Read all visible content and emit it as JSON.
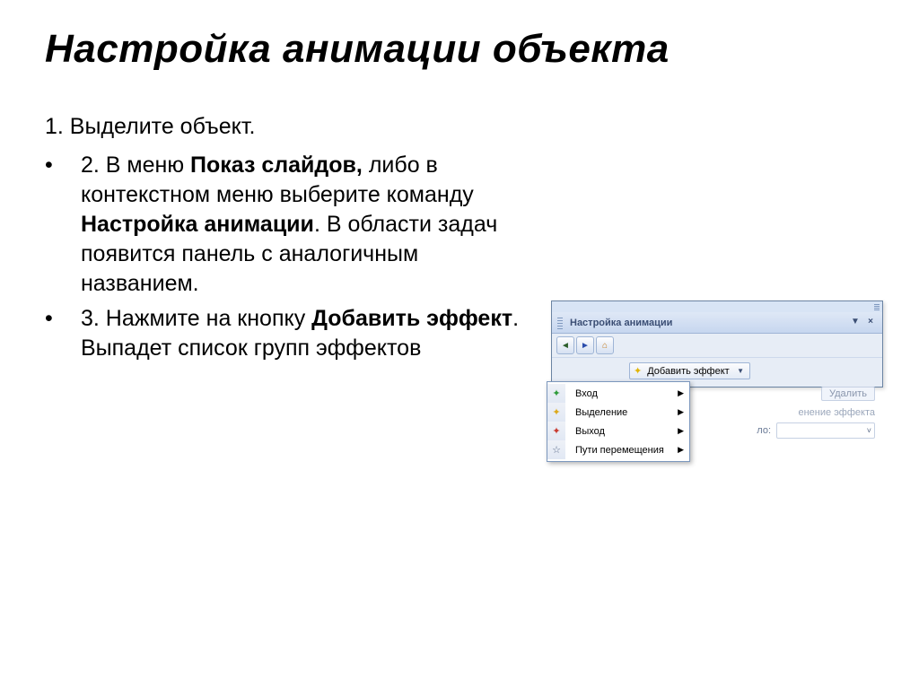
{
  "title": "Настройка анимации объекта",
  "steps": {
    "one_num": "1.",
    "one_text": " Выделите объект.",
    "two_prefix": "2. В меню ",
    "two_bold1": "Показ слайдов,",
    "two_mid1": " либо в контекстном меню выберите команду ",
    "two_bold2": "Настройка анимации",
    "two_mid2": ". В области задач появится панель с аналогичным названием.",
    "three_prefix": "3. Нажмите на кнопку ",
    "three_bold": "Добавить эффект",
    "three_rest": ". Выпадет список групп эффектов"
  },
  "panel": {
    "title": "Настройка анимации",
    "add_effect": "Добавить эффект",
    "delete": "Удалить",
    "change_effect": "енение эффекта",
    "start_label": "ло:",
    "menu": {
      "entry": "Вход",
      "emphasis": "Выделение",
      "exit": "Выход",
      "motion": "Пути перемещения"
    }
  }
}
